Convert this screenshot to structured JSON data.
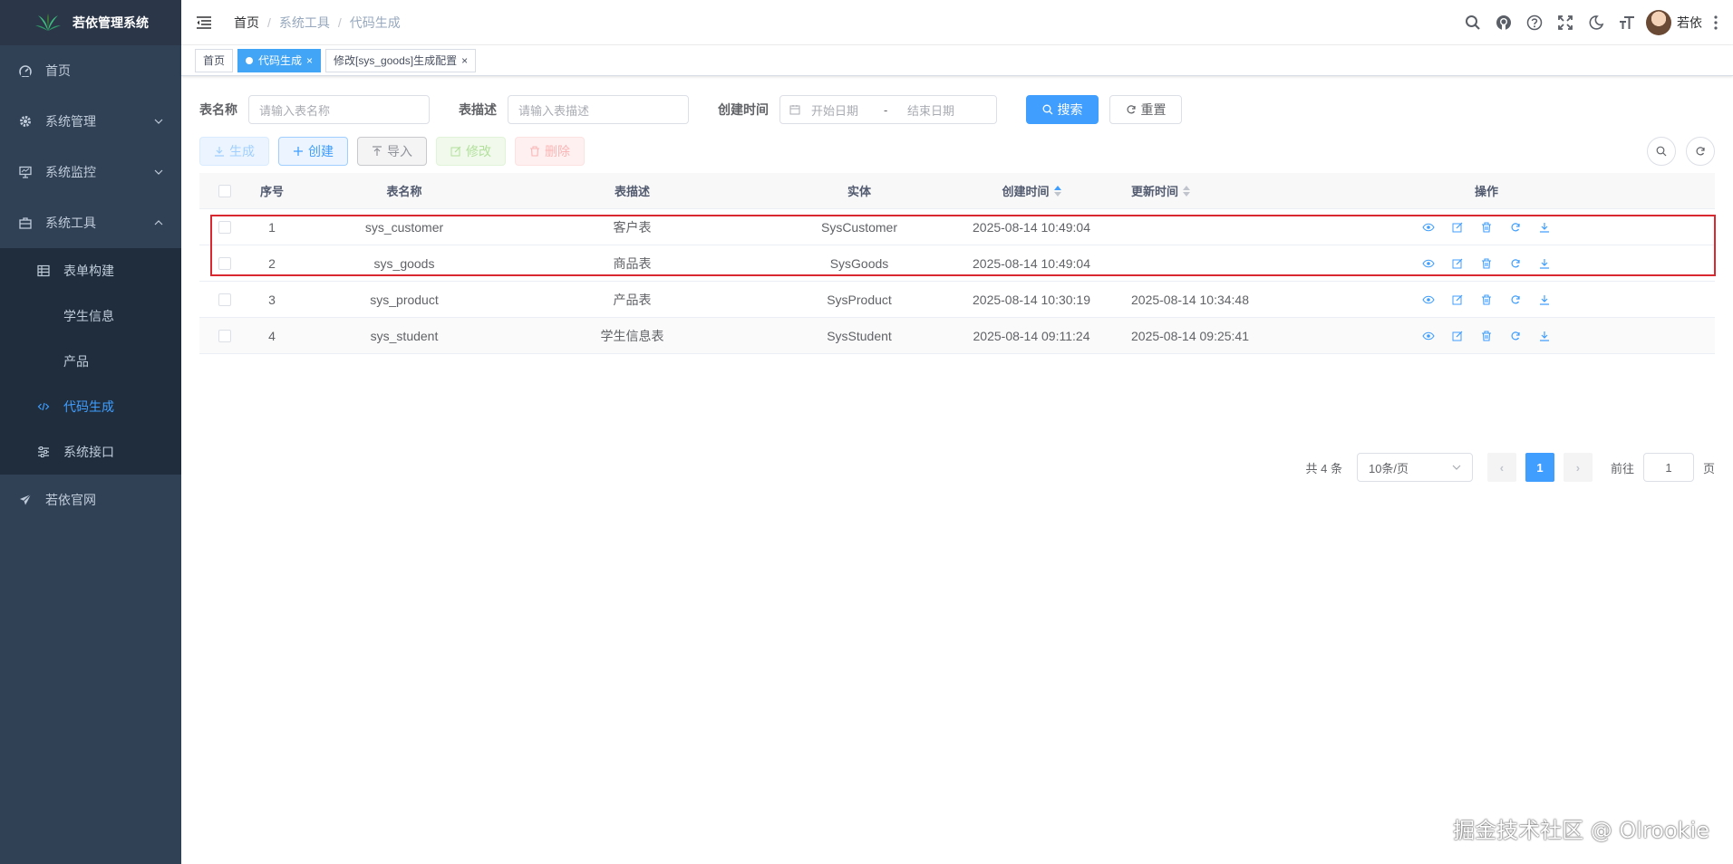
{
  "sidebar": {
    "title": "若依管理系统",
    "items": [
      {
        "label": "首页",
        "icon": "dashboard-icon"
      },
      {
        "label": "系统管理",
        "icon": "gear-icon"
      },
      {
        "label": "系统监控",
        "icon": "monitor-icon"
      },
      {
        "label": "系统工具",
        "icon": "toolbox-icon"
      }
    ],
    "tool_sub": [
      {
        "label": "表单构建",
        "icon": "table-icon"
      },
      {
        "label": "学生信息"
      },
      {
        "label": "产品"
      },
      {
        "label": "代码生成",
        "icon": "code-icon"
      },
      {
        "label": "系统接口",
        "icon": "sliders-icon"
      }
    ],
    "website": {
      "label": "若依官网",
      "icon": "paper-plane-icon"
    }
  },
  "navbar": {
    "breadcrumb": [
      "首页",
      "系统工具",
      "代码生成"
    ],
    "user": "若依"
  },
  "tags": [
    {
      "label": "首页"
    },
    {
      "label": "代码生成"
    },
    {
      "label": "修改[sys_goods]生成配置"
    }
  ],
  "search": {
    "table_name_label": "表名称",
    "table_name_placeholder": "请输入表名称",
    "table_desc_label": "表描述",
    "table_desc_placeholder": "请输入表描述",
    "create_time_label": "创建时间",
    "start_placeholder": "开始日期",
    "range_sep": "-",
    "end_placeholder": "结束日期",
    "search_btn": "搜索",
    "reset_btn": "重置"
  },
  "toolbar": {
    "generate": "生成",
    "create": "创建",
    "import": "导入",
    "edit": "修改",
    "delete": "删除"
  },
  "table": {
    "headers": [
      "序号",
      "表名称",
      "表描述",
      "实体",
      "创建时间",
      "更新时间",
      "操作"
    ],
    "rows": [
      {
        "idx": "1",
        "name": "sys_customer",
        "desc": "客户表",
        "entity": "SysCustomer",
        "created": "2025-08-14 10:49:04",
        "updated": ""
      },
      {
        "idx": "2",
        "name": "sys_goods",
        "desc": "商品表",
        "entity": "SysGoods",
        "created": "2025-08-14 10:49:04",
        "updated": ""
      },
      {
        "idx": "3",
        "name": "sys_product",
        "desc": "产品表",
        "entity": "SysProduct",
        "created": "2025-08-14 10:30:19",
        "updated": "2025-08-14 10:34:48"
      },
      {
        "idx": "4",
        "name": "sys_student",
        "desc": "学生信息表",
        "entity": "SysStudent",
        "created": "2025-08-14 09:11:24",
        "updated": "2025-08-14 09:25:41"
      }
    ]
  },
  "pagination": {
    "total": "共 4 条",
    "page_size": "10条/页",
    "current_page": "1",
    "goto_prefix": "前往",
    "goto_value": "1",
    "goto_suffix": "页"
  },
  "watermark": "掘金技术社区 @ Olrookie",
  "colors": {
    "primary": "#409eff",
    "sidebar_bg": "#304156",
    "highlight": "#d9282f"
  }
}
